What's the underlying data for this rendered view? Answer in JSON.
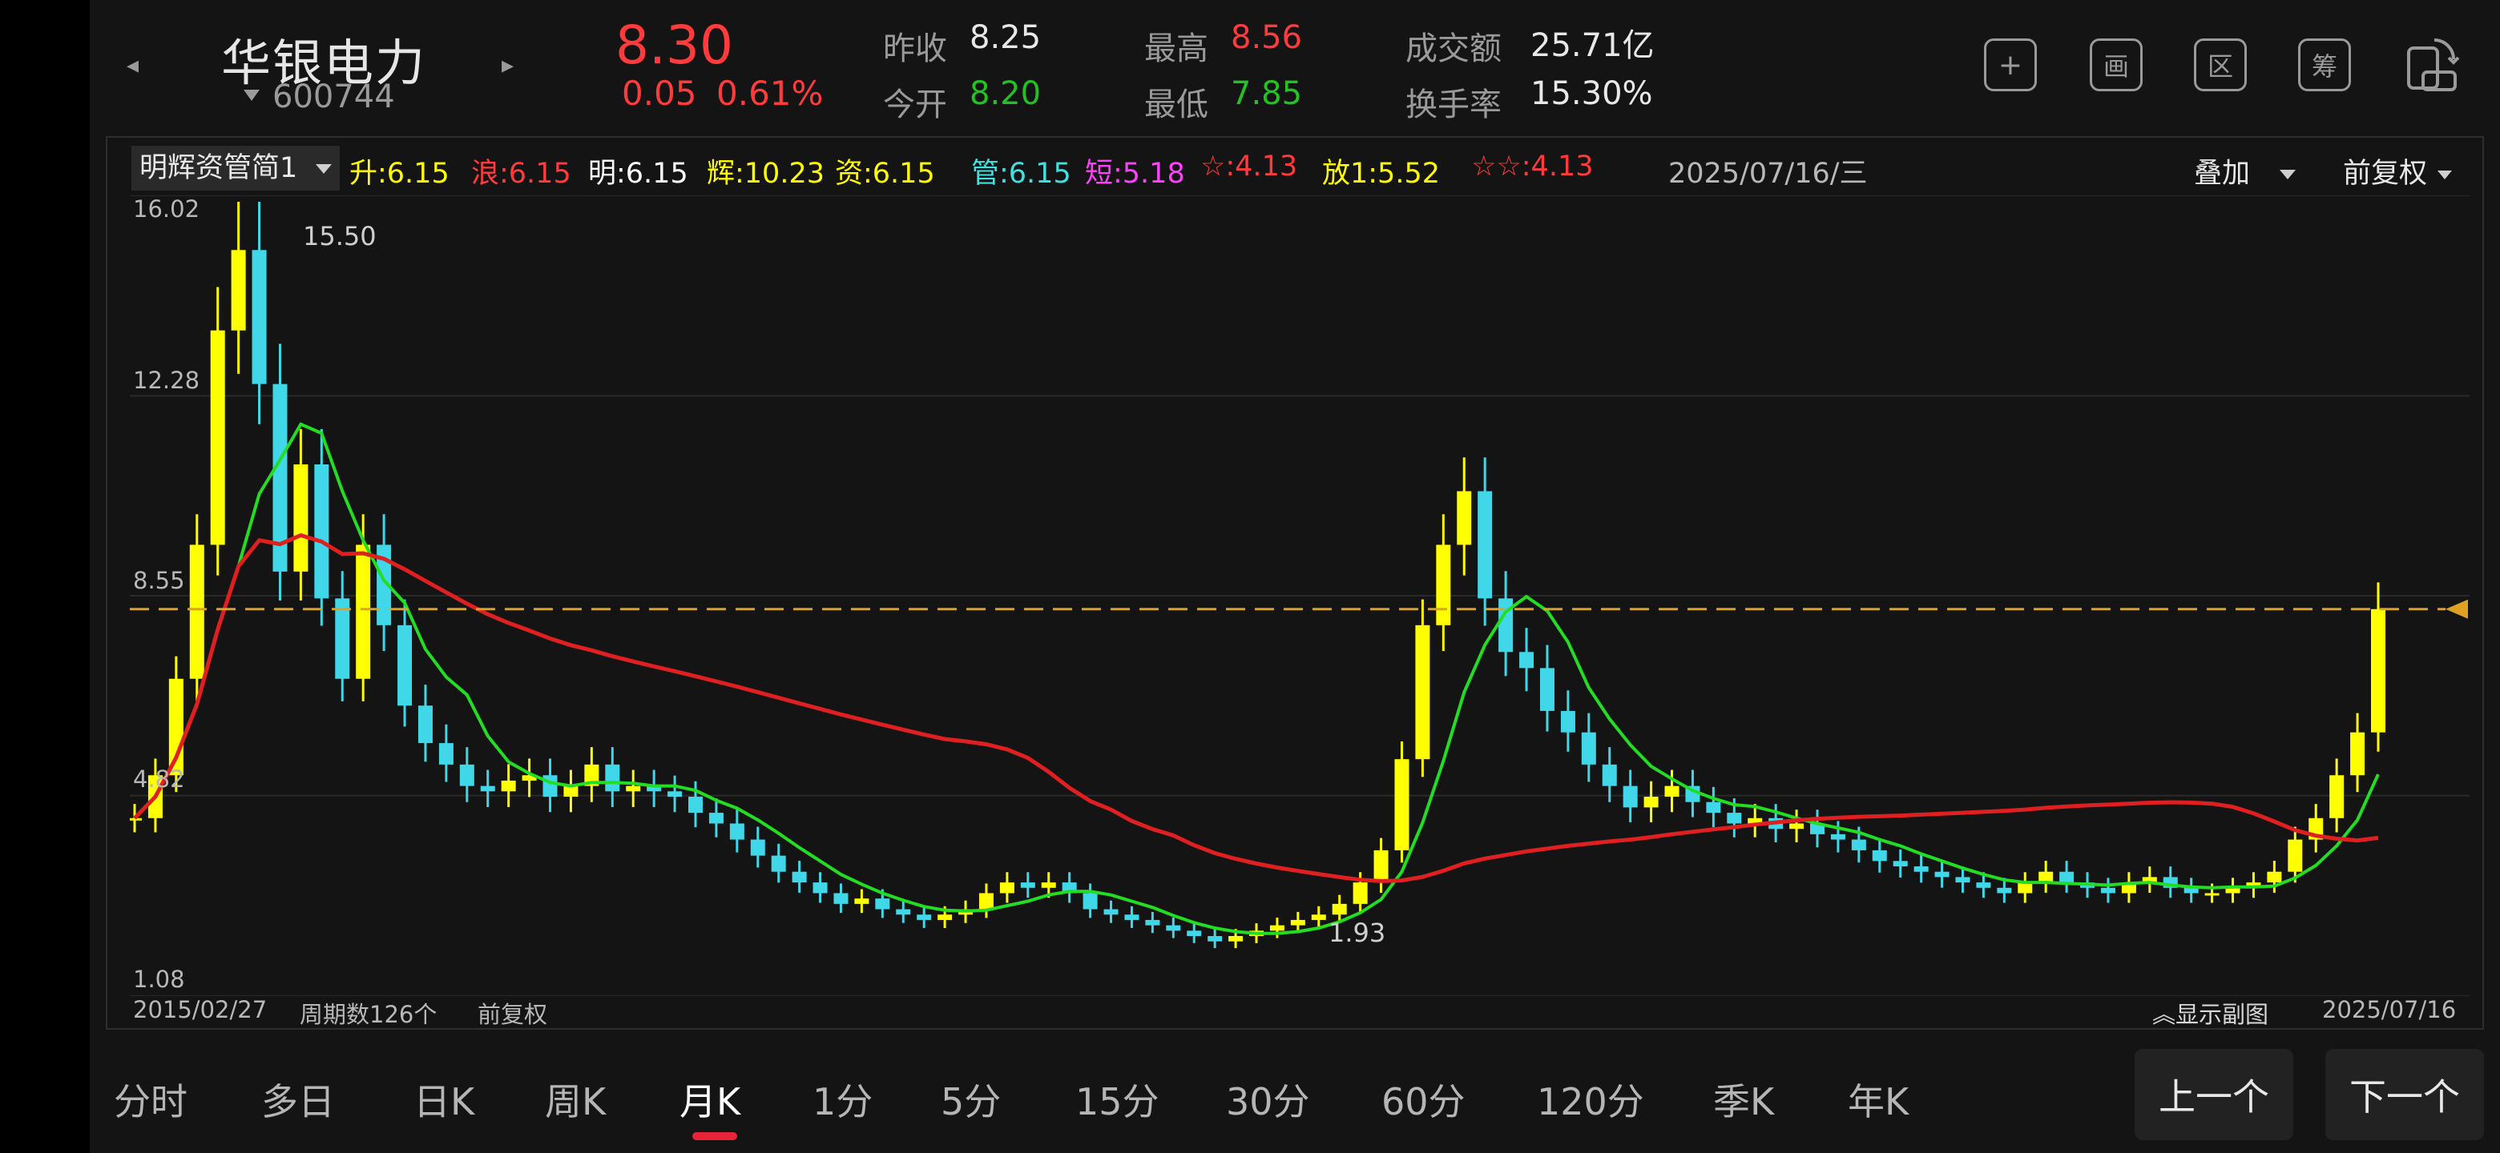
{
  "header": {
    "stock_name": "华银电力",
    "stock_code": "600744",
    "price": "8.30",
    "change_abs": "0.05",
    "change_pct": "0.61%",
    "prev_close_label": "昨收",
    "prev_close": "8.25",
    "open_label": "今开",
    "open": "8.20",
    "high_label": "最高",
    "high": "8.56",
    "low_label": "最低",
    "low": "7.85",
    "amount_label": "成交额",
    "amount": "25.71亿",
    "turnover_label": "换手率",
    "turnover": "15.30%",
    "nav_prev_icon": "chevron-left-icon",
    "nav_next_icon": "chevron-right-icon"
  },
  "toolbar": {
    "add_glyph": "+",
    "chart_glyph": "画",
    "range_glyph": "区",
    "chip_glyph": "筹",
    "icons": [
      "add-icon",
      "draw-icon",
      "range-icon",
      "chip-icon",
      "rotate-screen-icon"
    ]
  },
  "indicator": {
    "selected": "明辉资管简1",
    "items": [
      {
        "label": "升:",
        "value": "6.15",
        "color": "#ffff00"
      },
      {
        "label": "浪:",
        "value": "6.15",
        "color": "#ff3b3b"
      },
      {
        "label": "明:",
        "value": "6.15",
        "color": "#ffffff"
      },
      {
        "label": "辉:",
        "value": "10.23",
        "color": "#ffff00"
      },
      {
        "label": "资:",
        "value": "6.15",
        "color": "#ffff00"
      },
      {
        "label": "管:",
        "value": "6.15",
        "color": "#40e0e0"
      },
      {
        "label": "短:",
        "value": "5.18",
        "color": "#ff40ff"
      },
      {
        "label": "☆:",
        "value": "4.13",
        "color": "#ff3b3b"
      },
      {
        "label": "放1:",
        "value": "5.52",
        "color": "#ffff00"
      },
      {
        "label": "☆☆:",
        "value": "4.13",
        "color": "#ff3b3b"
      }
    ],
    "date": "2025/07/16/三",
    "overlay_label": "叠加",
    "adjust_label": "前复权"
  },
  "chart_data": {
    "type": "candlestick",
    "period": "monthly",
    "y_ticks": [
      "16.02",
      "12.28",
      "8.55",
      "4.82",
      "1.08"
    ],
    "ylim": [
      1.08,
      16.02
    ],
    "max_label": "15.50",
    "min_label": "1.93",
    "current_price": 8.3,
    "start_date": "2015/02/27",
    "end_date": "2025/07/16",
    "period_count_label": "周期数126个",
    "adjust_note": "前复权",
    "show_sub_label": "显示副图",
    "colors": {
      "up": "#ffff00",
      "down": "#40d8e8",
      "ma_short": "#22dd22",
      "ma_long": "#e02020",
      "ref_line": "#e0a020"
    }
  },
  "tabs": [
    "分时",
    "多日",
    "日K",
    "周K",
    "月K",
    "1分",
    "5分",
    "15分",
    "30分",
    "60分",
    "120分",
    "季K",
    "年K"
  ],
  "active_tab": "月K",
  "footer": {
    "prev_label": "上一个",
    "next_label": "下一个"
  }
}
